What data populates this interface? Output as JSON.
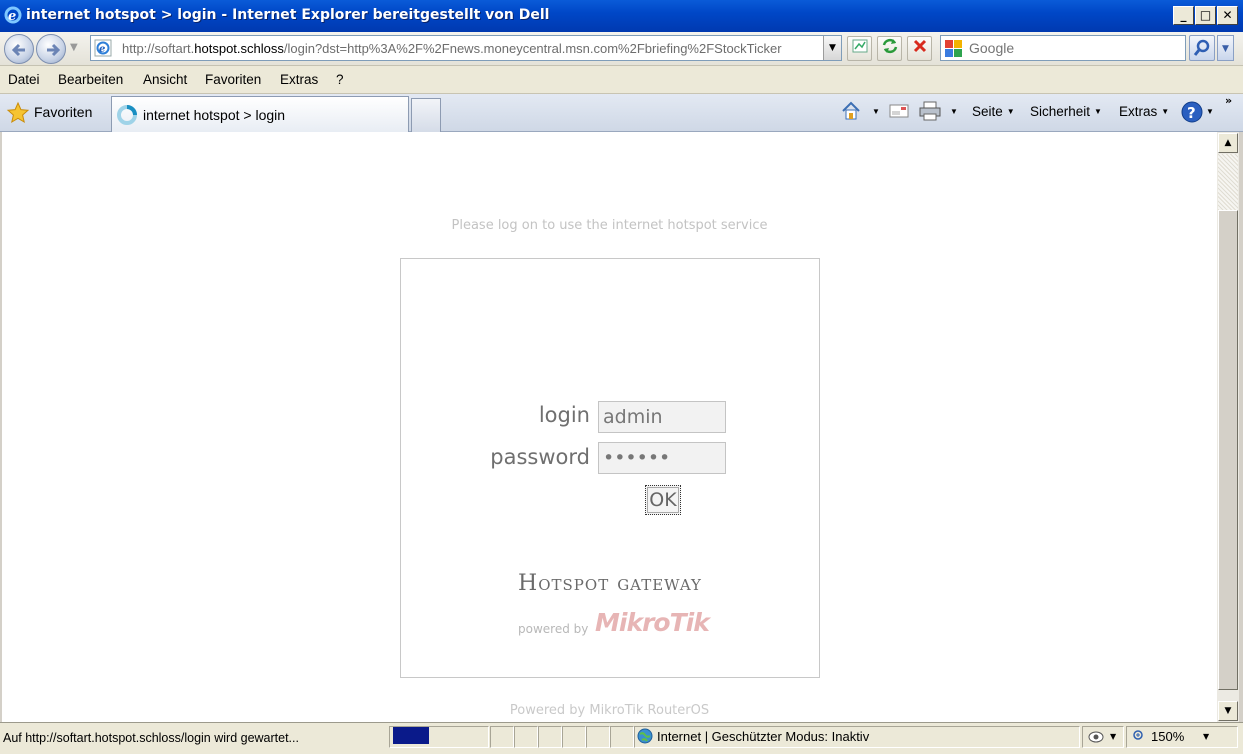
{
  "window": {
    "title": "internet hotspot > login - Internet Explorer bereitgestellt von Dell"
  },
  "address": {
    "url_prefix": "http://softart.",
    "url_host": "hotspot.schloss",
    "url_rest": "/login?dst=http%3A%2F%2Fnews.moneycentral.msn.com%2Fbriefing%2FStockTicker",
    "search_placeholder": "Google"
  },
  "menu": [
    "Datei",
    "Bearbeiten",
    "Ansicht",
    "Favoriten",
    "Extras",
    "?"
  ],
  "commandbar": {
    "favorites_label": "Favoriten",
    "tab_title": "internet hotspot > login",
    "page_label": "Seite",
    "security_label": "Sicherheit",
    "extras_label": "Extras"
  },
  "content": {
    "notice": "Please log on to use the internet hotspot service",
    "login_label": "login",
    "login_value": "admin",
    "password_label": "password",
    "password_value": "••••••",
    "ok_label": "OK",
    "brand_title": "Hotspot gateway",
    "powered_by": "powered by",
    "mikrotik_logo": "MikroTik",
    "footer": "Powered by MikroTik RouterOS"
  },
  "statusbar": {
    "status_text": "Auf http://softart.hotspot.schloss/login wird gewartet...",
    "zone_text": "Internet | Geschützter Modus: Inaktiv",
    "zoom_text": "150%"
  },
  "colors": {
    "titlebar": "#0047c7",
    "progress": "#0a1a8a",
    "mikrotik": "#e7b5b5"
  }
}
